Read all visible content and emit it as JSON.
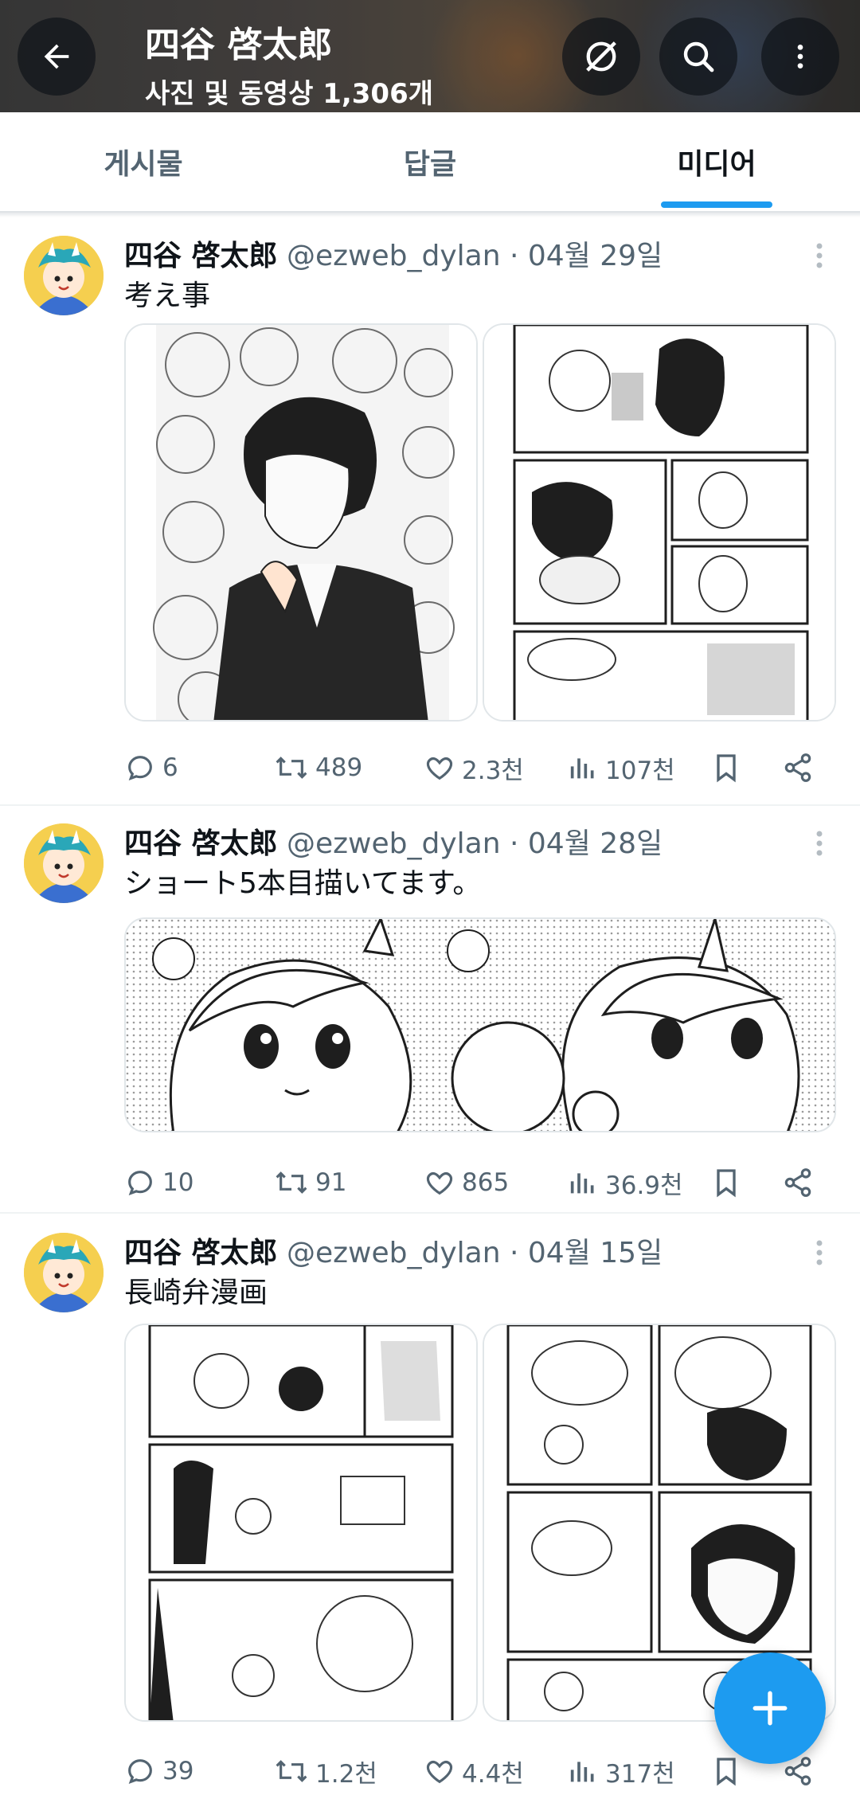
{
  "header": {
    "title": "四谷 啓太郎",
    "subtitle": "사진 및 동영상 1,306개"
  },
  "tabs": [
    {
      "label": "게시물"
    },
    {
      "label": "답글"
    },
    {
      "label": "미디어",
      "active": true
    }
  ],
  "colors": {
    "accent": "#1d9bf0",
    "text": "#0f1419",
    "muted": "#536471"
  },
  "icons": {
    "back": "arrow-left-icon",
    "hide": "eye-off-icon",
    "search": "search-icon",
    "more": "more-vertical-icon",
    "reply": "comment-icon",
    "retweet": "retweet-icon",
    "like": "heart-icon",
    "views": "bar-chart-icon",
    "bookmark": "bookmark-icon",
    "share": "share-icon",
    "compose": "plus-icon"
  },
  "posts": [
    {
      "name": "四谷 啓太郎",
      "handle": "@ezweb_dylan",
      "date": "04월 29일",
      "text": "考え事",
      "replies": "6",
      "retweets": "489",
      "likes": "2.3천",
      "views": "107천"
    },
    {
      "name": "四谷 啓太郎",
      "handle": "@ezweb_dylan",
      "date": "04월 28일",
      "text": "ショート5本目描いてます。",
      "replies": "10",
      "retweets": "91",
      "likes": "865",
      "views": "36.9천"
    },
    {
      "name": "四谷 啓太郎",
      "handle": "@ezweb_dylan",
      "date": "04월 15일",
      "text": "長崎弁漫画",
      "replies": "39",
      "retweets": "1.2천",
      "likes": "4.4천",
      "views": "317천"
    }
  ]
}
